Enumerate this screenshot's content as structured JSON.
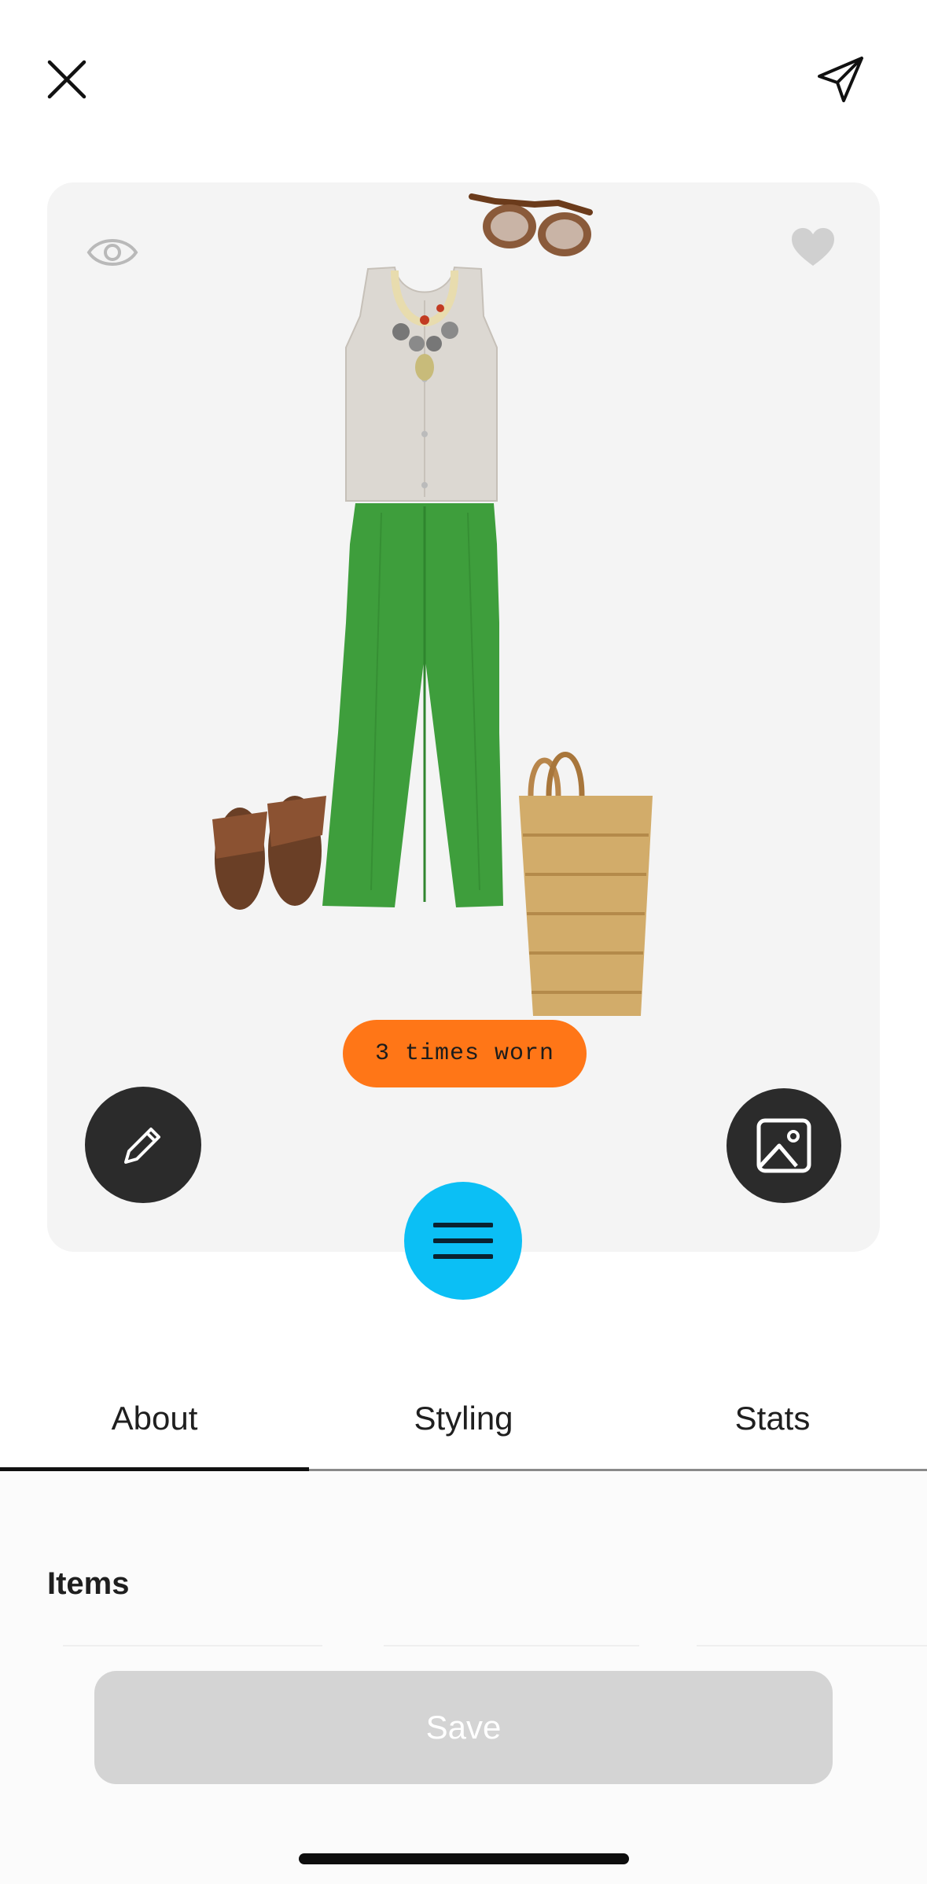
{
  "outfit": {
    "worn_label": "3 times worn",
    "items_in_image": [
      "sunglasses-icon",
      "tank-top",
      "necklace",
      "wide-leg-trousers",
      "sandals",
      "straw-tote-bag"
    ]
  },
  "icons": {
    "close": "close-icon",
    "share": "send-icon",
    "visibility": "eye-icon",
    "favorite": "heart-icon",
    "edit": "pencil-icon",
    "photo": "image-icon",
    "menu": "menu-icon"
  },
  "tabs": [
    {
      "label": "About",
      "active": true
    },
    {
      "label": "Styling",
      "active": false
    },
    {
      "label": "Stats",
      "active": false
    }
  ],
  "items_section": {
    "title": "Items"
  },
  "save_button": {
    "label": "Save",
    "enabled": false
  },
  "colors": {
    "worn_pill": "#ff7617",
    "menu_fab": "#0bbff5",
    "dark_button": "#2b2b2b",
    "save_disabled": "#d4d4d4",
    "card_bg": "#f4f4f4"
  }
}
